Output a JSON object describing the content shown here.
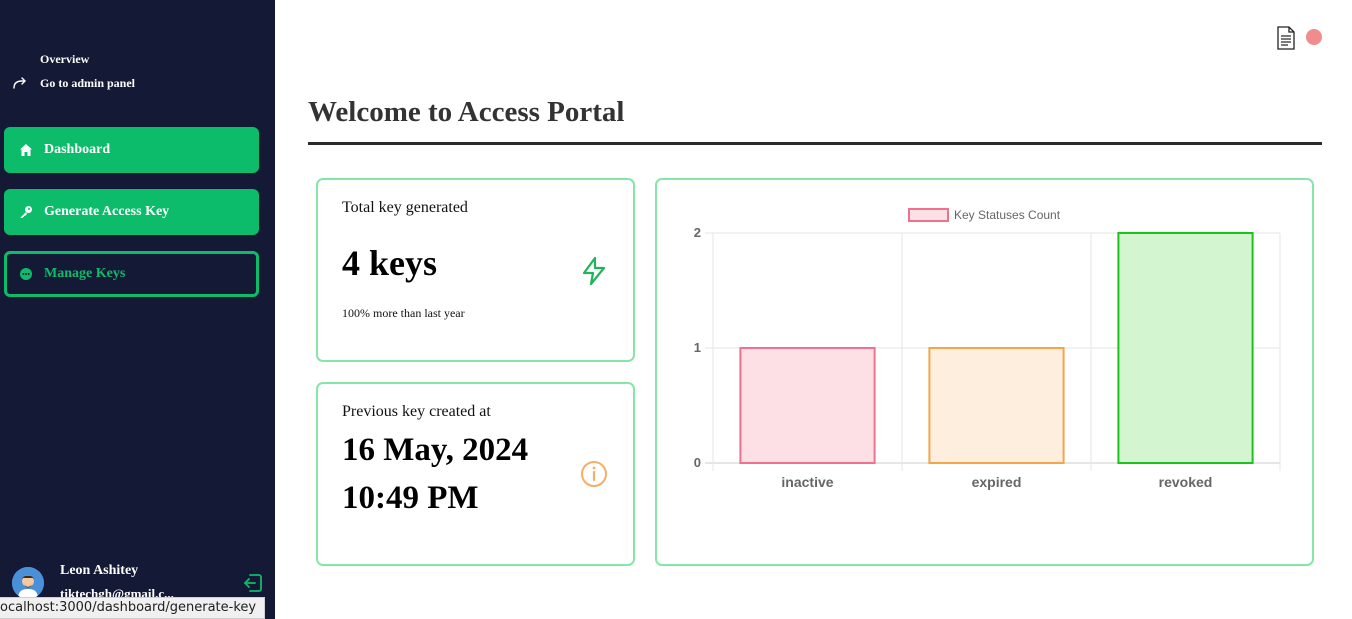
{
  "sidebar": {
    "overview_label": "Overview",
    "admin_label": "Go to admin panel",
    "nav": {
      "dashboard": "Dashboard",
      "generate": "Generate Access Key",
      "manage": "Manage Keys"
    },
    "user": {
      "name": "Leon Ashitey",
      "email": "tiktechgh@gmail.c..."
    },
    "accent": "#0dbc6a",
    "background": "#141a36"
  },
  "status_bar": {
    "url": "ocalhost:3000/dashboard/generate-key"
  },
  "header": {
    "title": "Welcome to Access Portal",
    "doc_icon": "document-icon",
    "record_icon": "red-dot-icon"
  },
  "cards": {
    "total_keys": {
      "label": "Total key generated",
      "value": "4 keys",
      "note": "100% more than last year",
      "icon": "bolt-icon"
    },
    "previous_key": {
      "label": "Previous key created at",
      "date": "16 May, 2024",
      "time": "10:49 PM",
      "icon": "info-icon"
    }
  },
  "chart_data": {
    "type": "bar",
    "categories": [
      "inactive",
      "expired",
      "revoked"
    ],
    "series": [
      {
        "name": "Key Statuses Count",
        "values": [
          1,
          1,
          2
        ]
      }
    ],
    "bar_fill_colors": [
      "#fde0e6",
      "#feeedd",
      "#d3f5d0"
    ],
    "bar_stroke_colors": [
      "#f0708f",
      "#f2a54a",
      "#1ec21e"
    ],
    "ylim": [
      0,
      2
    ],
    "yticks": [
      "0",
      "1",
      "2"
    ],
    "grid": true,
    "legend_position": "top",
    "xlabel": "",
    "ylabel": ""
  }
}
